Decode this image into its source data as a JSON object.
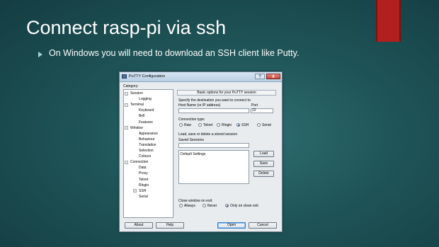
{
  "slide": {
    "title": "Connect rasp-pi via ssh",
    "bullet": "On Windows you will need to download an SSH client like Putty."
  },
  "window": {
    "title": "PuTTY Configuration",
    "help_label": "?",
    "close_label": "X"
  },
  "category": {
    "label": "Category:",
    "items": [
      {
        "label": "Session",
        "level": 0,
        "expander": "minus"
      },
      {
        "label": "Logging",
        "level": 1,
        "expander": ""
      },
      {
        "label": "Terminal",
        "level": 0,
        "expander": "minus"
      },
      {
        "label": "Keyboard",
        "level": 1,
        "expander": ""
      },
      {
        "label": "Bell",
        "level": 1,
        "expander": ""
      },
      {
        "label": "Features",
        "level": 1,
        "expander": ""
      },
      {
        "label": "Window",
        "level": 0,
        "expander": "minus"
      },
      {
        "label": "Appearance",
        "level": 1,
        "expander": ""
      },
      {
        "label": "Behaviour",
        "level": 1,
        "expander": ""
      },
      {
        "label": "Translation",
        "level": 1,
        "expander": ""
      },
      {
        "label": "Selection",
        "level": 1,
        "expander": ""
      },
      {
        "label": "Colours",
        "level": 1,
        "expander": ""
      },
      {
        "label": "Connection",
        "level": 0,
        "expander": "minus"
      },
      {
        "label": "Data",
        "level": 1,
        "expander": ""
      },
      {
        "label": "Proxy",
        "level": 1,
        "expander": ""
      },
      {
        "label": "Telnet",
        "level": 1,
        "expander": ""
      },
      {
        "label": "Rlogin",
        "level": 1,
        "expander": ""
      },
      {
        "label": "SSH",
        "level": 1,
        "expander": "plus"
      },
      {
        "label": "Serial",
        "level": 1,
        "expander": ""
      }
    ]
  },
  "session": {
    "header": "Basic options for your PuTTY session",
    "dest_label": "Specify the destination you want to connect to",
    "host_label": "Host Name (or IP address)",
    "host_value": "",
    "port_label": "Port",
    "port_value": "22",
    "conn_type_label": "Connection type:",
    "conn_types": [
      {
        "label": "Raw",
        "selected": false
      },
      {
        "label": "Telnet",
        "selected": false
      },
      {
        "label": "Rlogin",
        "selected": false
      },
      {
        "label": "SSH",
        "selected": true
      },
      {
        "label": "Serial",
        "selected": false
      }
    ],
    "load_save_label": "Load, save or delete a stored session",
    "saved_sessions_label": "Saved Sessions",
    "saved_sessions_value": "",
    "sessions_list": [
      "Default Settings"
    ],
    "load_label": "Load",
    "save_label": "Save",
    "delete_label": "Delete",
    "close_label": "Close window on exit:",
    "close_options": [
      {
        "label": "Always",
        "selected": false
      },
      {
        "label": "Never",
        "selected": false
      },
      {
        "label": "Only on clean exit",
        "selected": true
      }
    ]
  },
  "footer": {
    "about_label": "About",
    "help_label": "Help",
    "open_label": "Open",
    "cancel_label": "Cancel"
  }
}
